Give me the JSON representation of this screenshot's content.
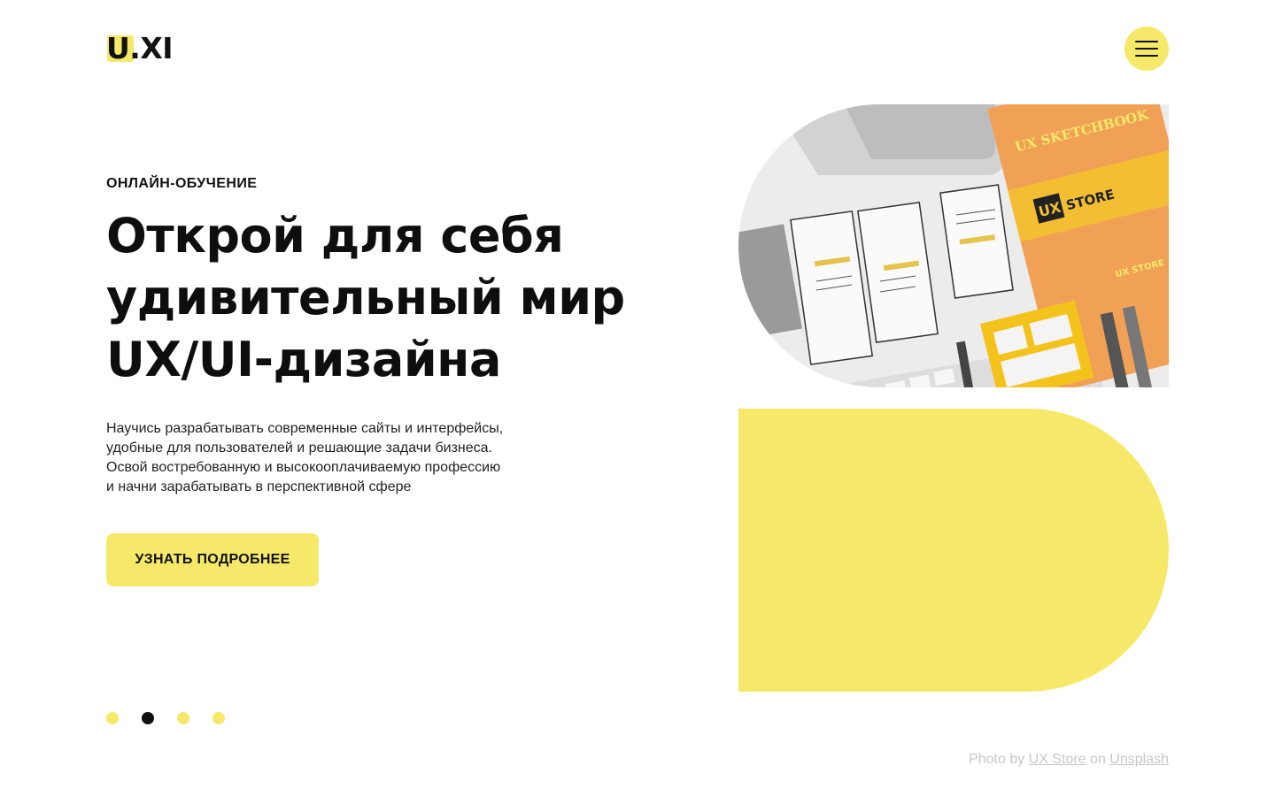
{
  "header": {
    "logo": "U.XI"
  },
  "hero": {
    "eyebrow": "ОНЛАЙН-ОБУЧЕНИЕ",
    "headline": [
      "Открой для себя",
      "удивительный мир",
      "UX/UI-дизайна"
    ],
    "description": [
      "Научись разрабатывать современные сайты и интерфейсы,",
      "удобные для пользователей и решающие задачи бизнеса.",
      "Освой востребованную и высокооплачиваемую профессию",
      "и начни зарабатывать в перспективной сфере"
    ],
    "cta_label": "УЗНАТЬ ПОДРОБНЕЕ"
  },
  "pagination": {
    "count": 4,
    "active_index": 1
  },
  "photo": {
    "book_title": "UX SKETCHBOOK",
    "brand_box": "UX",
    "brand_word": "STORE",
    "brand_small": "UX STORE"
  },
  "credit": {
    "prefix": "Photo by",
    "author": "UX Store",
    "middle": "on",
    "source": "Unsplash"
  },
  "colors": {
    "accent": "#F6E96A",
    "text": "#111111",
    "muted": "#c8c8c8",
    "book": "#F0A156"
  }
}
